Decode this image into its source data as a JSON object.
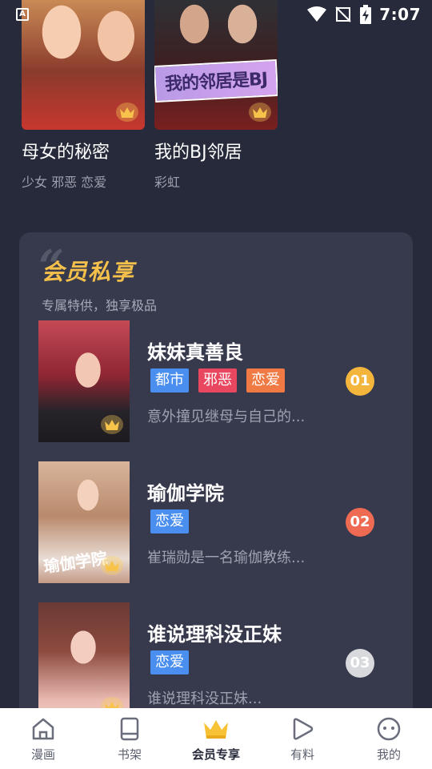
{
  "status_bar": {
    "time": "7:07",
    "left_icon": "A"
  },
  "top_comics": [
    {
      "title": "母女的秘密",
      "tags": "少女 邪恶 恋爱"
    },
    {
      "title": "我的BJ邻居",
      "tags": "彩虹",
      "cover_banner": "我的邻居是BJ"
    }
  ],
  "vip_section": {
    "title": "会员私享",
    "subtitle": "专属特供，独享极品",
    "items": [
      {
        "title": "妹妹真善良",
        "tags": [
          "都市",
          "邪恶",
          "恋爱"
        ],
        "description": "意外撞见继母与自己的...",
        "rank": "01"
      },
      {
        "title": "瑜伽学院",
        "tags": [
          "恋爱"
        ],
        "description": "崔瑞勋是一名瑜伽教练...",
        "rank": "02",
        "cover_text": "瑜伽学院"
      },
      {
        "title": "谁说理科没正妹",
        "tags": [
          "恋爱"
        ],
        "description": "谁说理科没正妹...",
        "rank": "03"
      }
    ]
  },
  "bottom_nav": [
    {
      "label": "漫画",
      "icon": "home-icon"
    },
    {
      "label": "书架",
      "icon": "bookshelf-icon"
    },
    {
      "label": "会员专享",
      "icon": "crown-icon",
      "active": true
    },
    {
      "label": "有料",
      "icon": "play-icon"
    },
    {
      "label": "我的",
      "icon": "profile-icon"
    }
  ],
  "colors": {
    "background": "#272a3a",
    "panel": "#373a4d",
    "accent_gold": "#f6c14b",
    "tag_blue": "#4a8ff0",
    "tag_pink": "#e8475f",
    "tag_orange": "#f07a44",
    "rank_1": "#f3b53b",
    "rank_2": "#ef6a52",
    "rank_3": "#d8d9dd"
  }
}
